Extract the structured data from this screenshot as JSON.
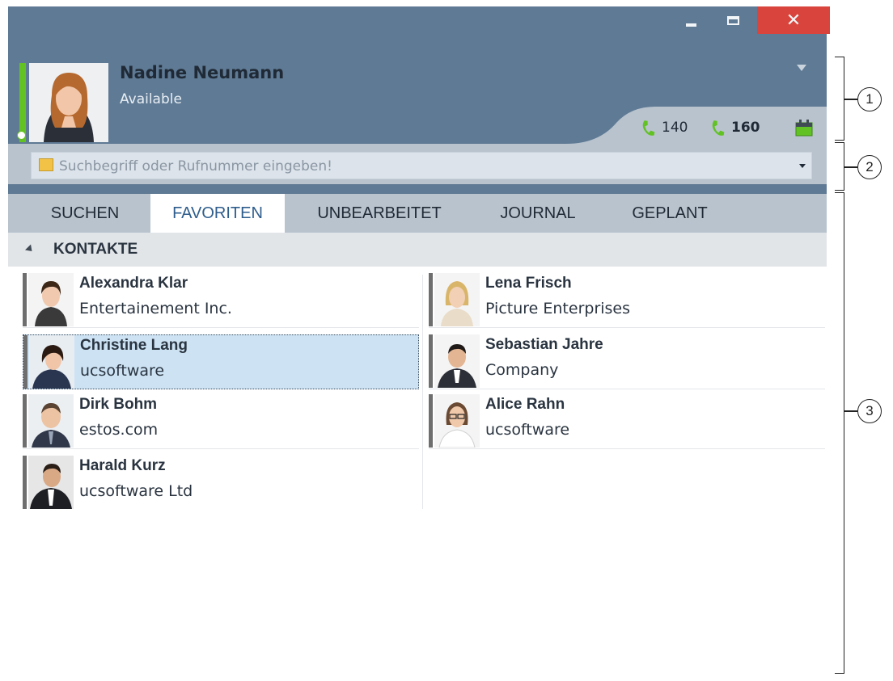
{
  "window": {
    "controls": {
      "minimize": "",
      "maximize": "",
      "close": "✕"
    }
  },
  "user": {
    "name": "Nadine Neumann",
    "status": "Available",
    "status_color": "#62c223"
  },
  "lines": [
    {
      "number": "140",
      "bold": false,
      "icon": "phone-icon"
    },
    {
      "number": "160",
      "bold": true,
      "icon": "phone-icon"
    }
  ],
  "search": {
    "placeholder": "Suchbegriff oder Rufnummer eingeben!"
  },
  "tabs": [
    {
      "label": "SUCHEN",
      "active": false
    },
    {
      "label": "FAVORITEN",
      "active": true
    },
    {
      "label": "UNBEARBEITET",
      "active": false
    },
    {
      "label": "JOURNAL",
      "active": false
    },
    {
      "label": "GEPLANT",
      "active": false
    }
  ],
  "group": {
    "label": "KONTAKTE"
  },
  "contacts": [
    {
      "name": "Alexandra Klar",
      "company": "Entertainement Inc.",
      "selected": false
    },
    {
      "name": "Lena Frisch",
      "company": "Picture Enterprises",
      "selected": false
    },
    {
      "name": "Christine Lang",
      "company": "ucsoftware",
      "selected": true
    },
    {
      "name": "Sebastian Jahre",
      "company": "Company",
      "selected": false
    },
    {
      "name": "Dirk Bohm",
      "company": "estos.com",
      "selected": false
    },
    {
      "name": "Alice Rahn",
      "company": "ucsoftware",
      "selected": false
    },
    {
      "name": "Harald Kurz",
      "company": "ucsoftware Ltd",
      "selected": false
    }
  ],
  "annotations": [
    "1",
    "2",
    "3"
  ],
  "colors": {
    "window_bg": "#5f7a94",
    "accent_blue": "#2e5d8c",
    "close_red": "#d9453c",
    "phone_green": "#62c223",
    "selected_bg": "#cde3f4"
  }
}
